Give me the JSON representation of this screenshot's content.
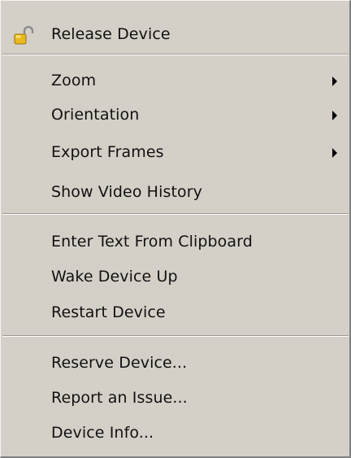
{
  "menu": {
    "items": [
      {
        "label": "Release Device",
        "icon": "unlock-icon",
        "submenu": false
      },
      {
        "label": "Zoom",
        "submenu": true
      },
      {
        "label": "Orientation",
        "submenu": true
      },
      {
        "label": "Export Frames",
        "submenu": true
      },
      {
        "label": "Show Video History",
        "submenu": false
      },
      {
        "label": "Enter Text From Clipboard",
        "submenu": false
      },
      {
        "label": "Wake Device Up",
        "submenu": false
      },
      {
        "label": "Restart Device",
        "submenu": false
      },
      {
        "label": "Reserve Device...",
        "submenu": false
      },
      {
        "label": "Report an Issue...",
        "submenu": false
      },
      {
        "label": "Device Info...",
        "submenu": false
      }
    ]
  },
  "colors": {
    "menu_bg": "#d4d0c8",
    "text": "#111111",
    "separator_dark": "#9a9893",
    "separator_light": "#ffffff",
    "lock_gold": "#e0b31a"
  }
}
